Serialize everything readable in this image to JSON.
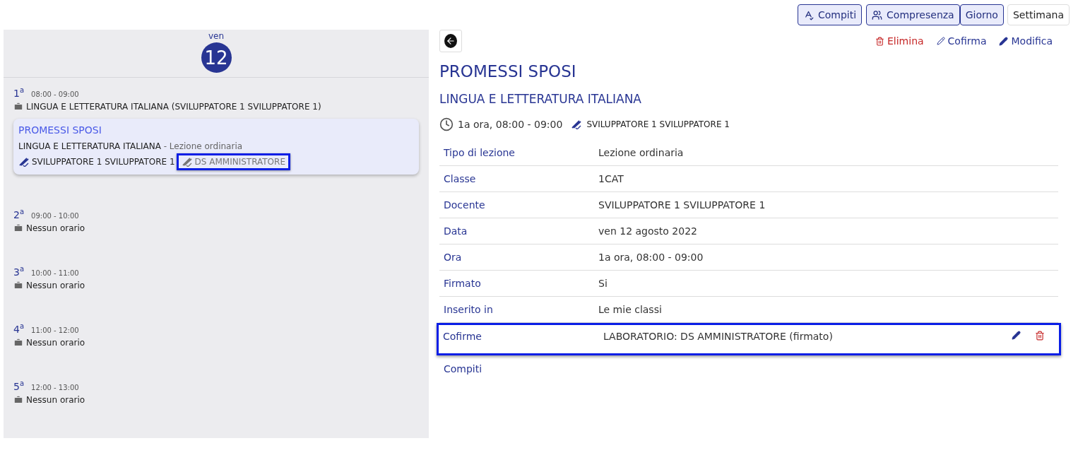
{
  "toolbar": [
    {
      "label": "Compiti",
      "kind": "toggle",
      "on": true
    },
    {
      "label": "Compresenza",
      "kind": "toggle",
      "on": true
    },
    {
      "label": "Giorno",
      "kind": "view",
      "selected": true
    },
    {
      "label": "Settimana",
      "kind": "view",
      "selected": false
    }
  ],
  "day": {
    "weekday": "ven",
    "number": "12"
  },
  "periods": [
    {
      "number": "1$^{a}$",
      "time": "08:00 - 09:00",
      "subject": "LINGUA E LETTERATURA ITALIANA (SVILUPPATORE 1 SVILUPPATORE 1)",
      "lessons": [
        {
          "title": "PROMESSI SPOSI",
          "subject": "LINGUA E LETTERATURA ITALIANA",
          "type": "- Lezione ordinaria",
          "teacher": "SVILUPPATORE 1 SVILUPPATORE 1",
          "cosigner": "DS AMMINISTRATORE",
          "highlighted": true
        }
      ]
    },
    {
      "number": "2$^{a}$",
      "time": "09:00 - 10:00",
      "subject": "Nessun orario"
    },
    {
      "number": "3$^{a}$",
      "time": "10:00 - 11:00",
      "subject": "Nessun orario"
    },
    {
      "number": "4$^{a}$",
      "time": "11:00 - 12:00",
      "subject": "Nessun orario"
    },
    {
      "number": "5$^{a}$",
      "time": "12:00 - 13:00",
      "subject": "Nessun orario"
    }
  ],
  "detail": {
    "actions": [
      {
        "label": "Elimina",
        "kind": "delete"
      },
      {
        "label": "Cofirma",
        "kind": "cosign"
      },
      {
        "label": "Modifica",
        "kind": "edit"
      }
    ],
    "title": "PROMESSI SPOSI",
    "subject": "LINGUA E LETTERATURA ITALIANA",
    "time": "1a ora, 08:00 - 09:00",
    "teacher": "SVILUPPATORE 1 SVILUPPATORE 1",
    "fields": [
      {
        "label": "Tipo di lezione",
        "value": "Lezione ordinaria"
      },
      {
        "label": "Classe",
        "value": "1CAT"
      },
      {
        "label": "Docente",
        "value": "SVILUPPATORE 1 SVILUPPATORE 1"
      },
      {
        "label": "Data",
        "value": "ven 12 agosto 2022"
      },
      {
        "label": "Ora",
        "value": "1a ora, 08:00 - 09:00"
      },
      {
        "label": "Firmato",
        "value": "Si"
      },
      {
        "label": "Inserito in",
        "value": "Le mie classi"
      }
    ],
    "cosign": {
      "label": "Cofirme",
      "value": "LABORATORIO: DS AMMINISTRATORE (firmato)",
      "highlighted": true
    },
    "homework": {
      "label": "Compiti"
    }
  }
}
